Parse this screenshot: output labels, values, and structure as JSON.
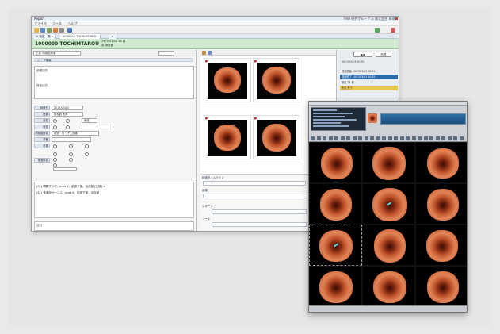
{
  "main_window": {
    "title": "Report",
    "title_right": "TRW 研究グループ  ◎ 株式会社",
    "menu": [
      "ファイル",
      "ツール",
      "ヘルプ"
    ],
    "tabs": [
      "☑ 検査一覧 ▾",
      "1000000 TOCHIMTAROU",
      "▾"
    ],
    "patient": {
      "name": "1000000  TOCHIMTAROU",
      "info_line1": "1970/01/01  58 歳",
      "info_line2": "男  消化器"
    },
    "exam_selector": "上部 内視鏡検査",
    "section_title": "オーダ情報",
    "notes_labels": [
      "依頼目的",
      "検査目的"
    ],
    "form_labels": [
      "検査日",
      "医師",
      "部位",
      "所見",
      "内視鏡所見",
      "診断",
      "処置",
      "検査所見"
    ],
    "form_values": [
      "2017/03/03",
      "内視鏡 太郎",
      "食道",
      "",
      "食道・胃・十二指腸",
      "",
      "",
      ""
    ],
    "findings": [
      {
        "tag": "[S1]",
        "text": "観察ブラ可、prob 1、粘液下部、出血部 [生検] ⊙"
      },
      {
        "tag": "[S1]",
        "text": "食道部分～ニユ、prob 8、粘液下部、出血部"
      }
    ],
    "comments_label": "追記",
    "right_pane": {
      "header": "所見",
      "date": "2017/03/03  10:32",
      "items": [
        "検査開始 2017/03/03 10:21",
        "検査終了 2017/03/03 10:45",
        "撮影 24 枚",
        "所見 有り"
      ],
      "confirm_label": "確定",
      "cancel_label": "取消"
    },
    "timeline_labels": [
      "検査タイムライン",
      "画像",
      "グループ",
      "ノート"
    ]
  },
  "viewer": {
    "panel_rows": 8,
    "grid_cols": 3,
    "grid_rows": 4
  }
}
